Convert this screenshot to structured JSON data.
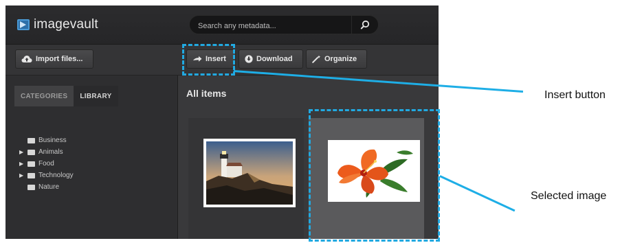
{
  "app": {
    "logo_text": "imagevault",
    "search": {
      "placeholder": "Search any metadata..."
    }
  },
  "toolbar": {
    "import_label": "Import files...",
    "insert_label": "Insert",
    "download_label": "Download",
    "organize_label": "Organize"
  },
  "sidebar": {
    "tabs": [
      {
        "label": "CATEGORIES",
        "active": true
      },
      {
        "label": "LIBRARY",
        "active": false
      }
    ],
    "categories": [
      {
        "label": "Business",
        "expandable": false
      },
      {
        "label": "Animals",
        "expandable": true
      },
      {
        "label": "Food",
        "expandable": true
      },
      {
        "label": "Technology",
        "expandable": true
      },
      {
        "label": "Nature",
        "expandable": false
      }
    ]
  },
  "content": {
    "title": "All items",
    "images": [
      {
        "subject": "lighthouse",
        "selected": false
      },
      {
        "subject": "hibiscus-flower",
        "selected": true
      }
    ]
  },
  "annotations": {
    "insert_label": "Insert button",
    "selected_label": "Selected image",
    "color": "#21a9e1"
  },
  "colors": {
    "topbar": "#2c2c2e",
    "panel": "#3b3b3d",
    "selected_tile": "#5a5a5c"
  }
}
